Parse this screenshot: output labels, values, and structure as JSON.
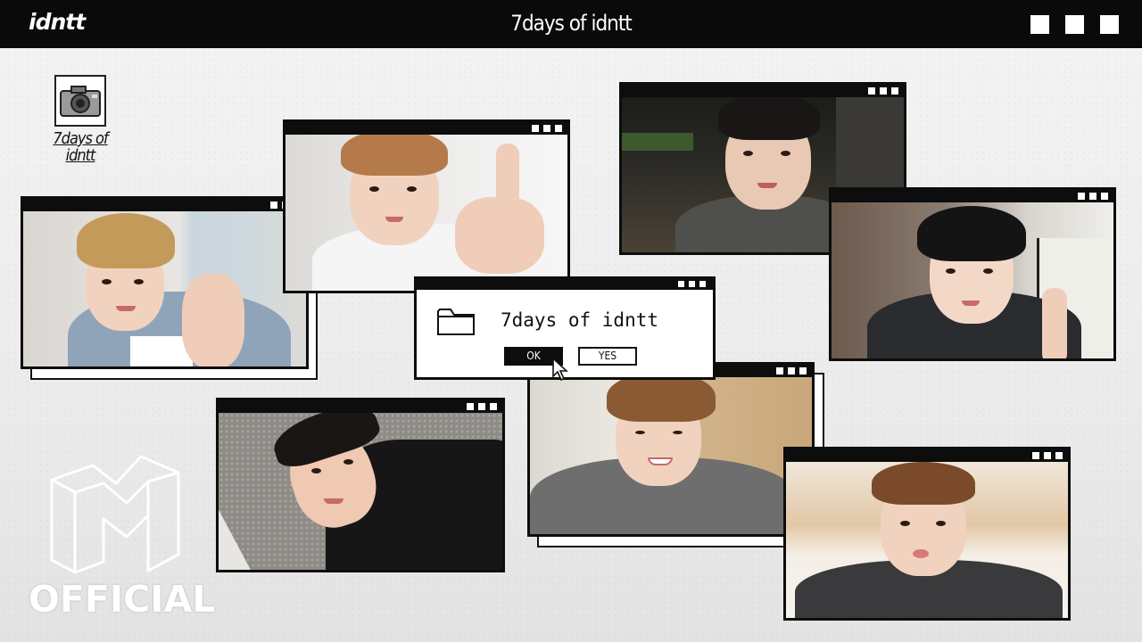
{
  "topbar": {
    "brand": "idntt",
    "title": "7days of idntt"
  },
  "desktop_icon": {
    "icon": "camera-icon",
    "label_line1": "7days of",
    "label_line2": "idntt"
  },
  "dialog": {
    "icon": "folder-icon",
    "title": "7days of idntt",
    "ok_label": "OK",
    "yes_label": "YES"
  },
  "logo": {
    "wordmark": "OFFICIAL"
  },
  "colors": {
    "bar": "#0a0a0a",
    "background": "#efefef",
    "window_frame": "#0d0d0d"
  }
}
